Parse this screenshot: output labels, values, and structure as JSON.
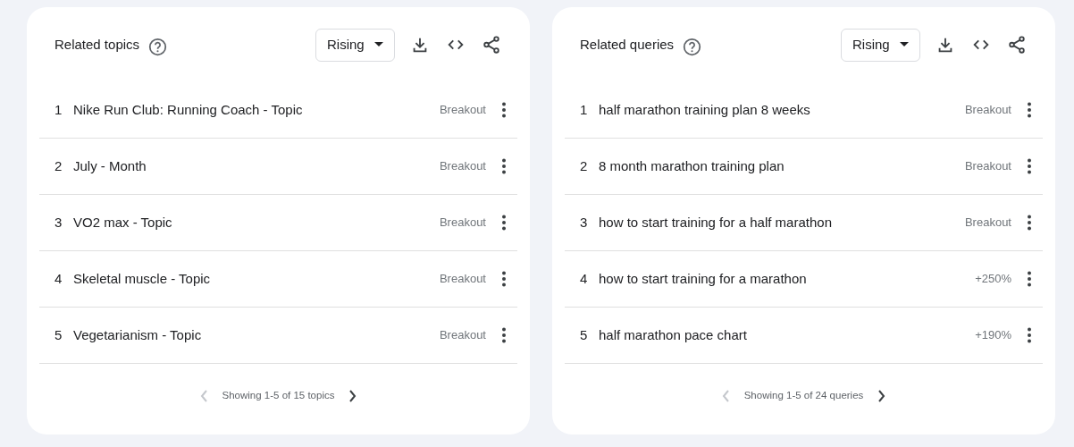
{
  "panels": [
    {
      "title": "Related topics",
      "dropdown": "Rising",
      "rows": [
        {
          "rank": "1",
          "label": "Nike Run Club: Running Coach - Topic",
          "value": "Breakout"
        },
        {
          "rank": "2",
          "label": "July - Month",
          "value": "Breakout"
        },
        {
          "rank": "3",
          "label": "VO2 max - Topic",
          "value": "Breakout"
        },
        {
          "rank": "4",
          "label": "Skeletal muscle - Topic",
          "value": "Breakout"
        },
        {
          "rank": "5",
          "label": "Vegetarianism - Topic",
          "value": "Breakout"
        }
      ],
      "pager": {
        "text": "Showing 1-5 of 15 topics",
        "prev_disabled": true,
        "next_disabled": false
      }
    },
    {
      "title": "Related queries",
      "dropdown": "Rising",
      "rows": [
        {
          "rank": "1",
          "label": "half marathon training plan 8 weeks",
          "value": "Breakout"
        },
        {
          "rank": "2",
          "label": "8 month marathon training plan",
          "value": "Breakout"
        },
        {
          "rank": "3",
          "label": "how to start training for a half marathon",
          "value": "Breakout"
        },
        {
          "rank": "4",
          "label": "how to start training for a marathon",
          "value": "+250%"
        },
        {
          "rank": "5",
          "label": "half marathon pace chart",
          "value": "+190%"
        }
      ],
      "pager": {
        "text": "Showing 1-5 of 24 queries",
        "prev_disabled": true,
        "next_disabled": false
      }
    }
  ]
}
